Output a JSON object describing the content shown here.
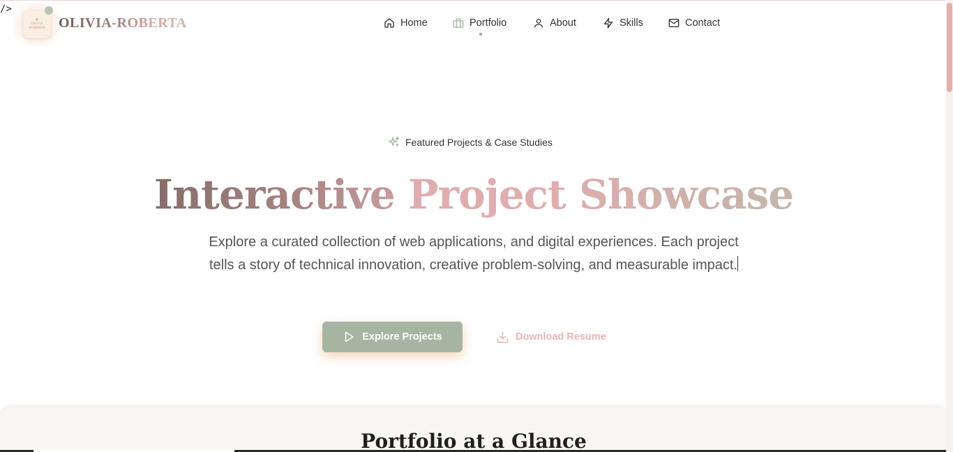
{
  "stray_text": "/>",
  "brand": {
    "name": "OLIVIA-ROBERTA",
    "logo_text_top": "OLIVIA",
    "logo_text_bottom": "ROBERTA"
  },
  "nav": {
    "items": [
      {
        "label": "Home",
        "icon": "home-icon"
      },
      {
        "label": "Portfolio",
        "icon": "briefcase-icon",
        "active": true
      },
      {
        "label": "About",
        "icon": "user-icon"
      },
      {
        "label": "Skills",
        "icon": "lightning-icon"
      },
      {
        "label": "Contact",
        "icon": "mail-icon"
      }
    ]
  },
  "hero": {
    "badge": "Featured Projects & Case Studies",
    "badge_icon": "sparkles-icon",
    "title_part1": "Interactive",
    "title_part2": "Project",
    "title_part3": "Showcase",
    "description": "Explore a curated collection of web applications, and digital experiences. Each project tells a story of technical innovation, creative problem-solving, and measurable impact.",
    "primary_button": "Explore Projects",
    "primary_icon": "play-icon",
    "secondary_button": "Download Resume",
    "secondary_icon": "download-icon"
  },
  "glance": {
    "title": "Portfolio at a Glance"
  },
  "colors": {
    "accent_sage": "#a6b5a1",
    "accent_pink": "#e0adaf",
    "brand_brown": "#866d6a",
    "scrollbar_thumb": "#e3b0b0"
  }
}
